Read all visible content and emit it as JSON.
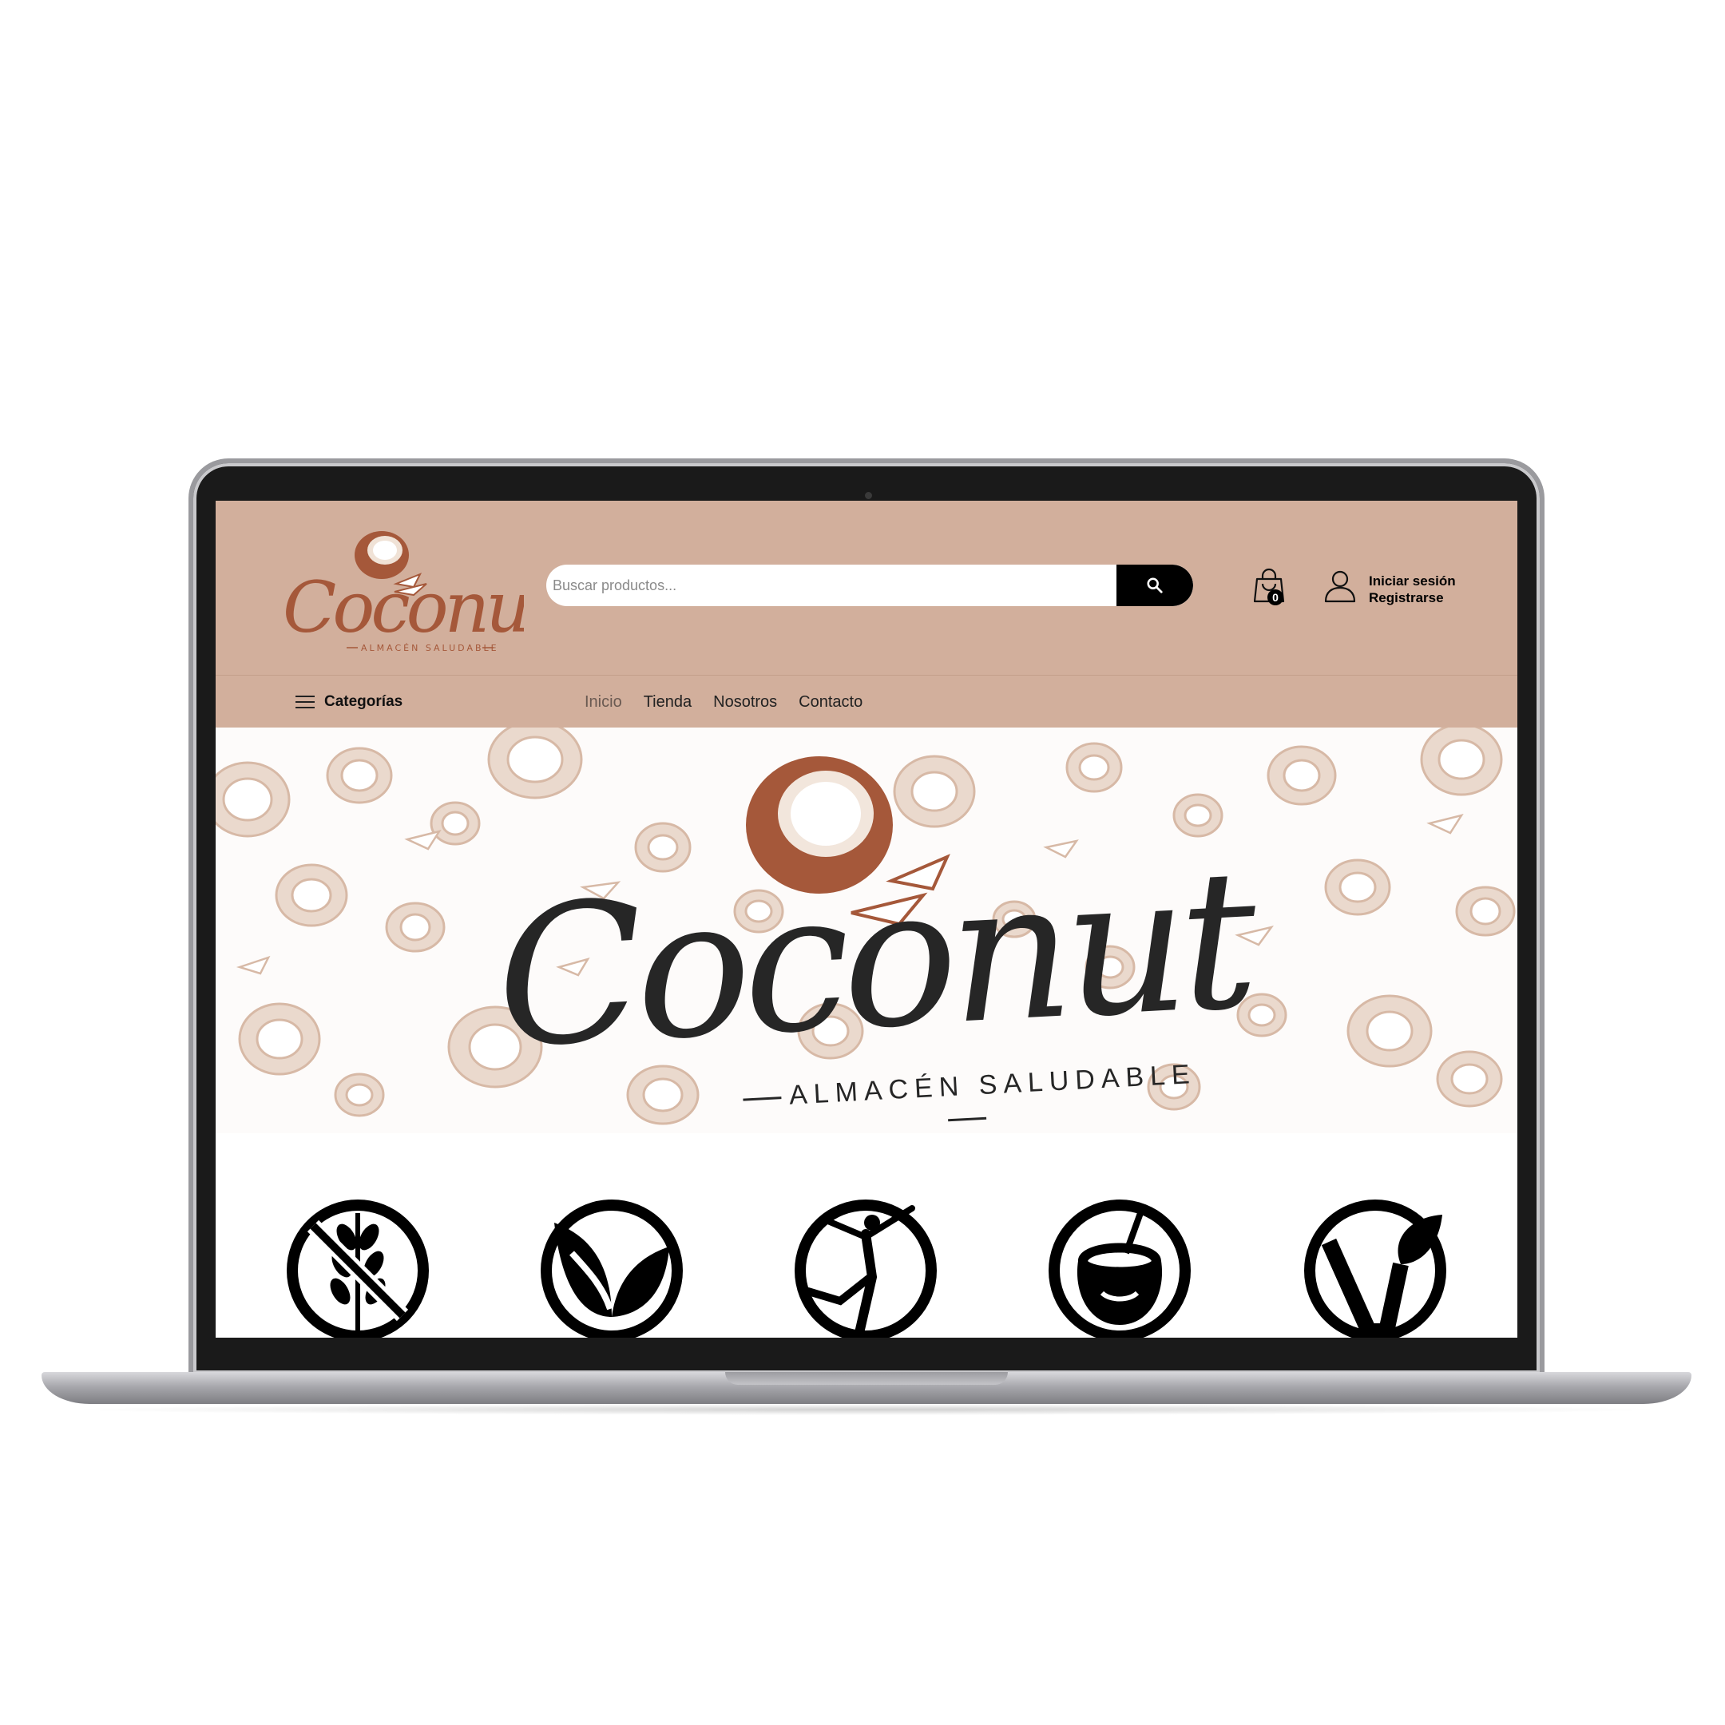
{
  "brand": {
    "name": "Coconut",
    "tagline": "ALMACÉN SALUDABLE"
  },
  "search": {
    "placeholder": "Buscar productos..."
  },
  "cart": {
    "count": "0"
  },
  "account": {
    "login_label": "Iniciar sesión",
    "register_label": "Registrarse"
  },
  "nav": {
    "categories_label": "Categorías",
    "menu": [
      {
        "label": "Inicio",
        "active": true
      },
      {
        "label": "Tienda",
        "active": false
      },
      {
        "label": "Nosotros",
        "active": false
      },
      {
        "label": "Contacto",
        "active": false
      }
    ]
  },
  "hero": {
    "title": "Coconut",
    "subtitle": "ALMACÉN SALUDABLE"
  },
  "badges": [
    {
      "icon": "gluten-free-icon"
    },
    {
      "icon": "natural-leaf-icon"
    },
    {
      "icon": "fitness-icon"
    },
    {
      "icon": "coconut-sugar-icon"
    },
    {
      "icon": "vegan-icon"
    }
  ],
  "colors": {
    "header_bg": "#d2af9c",
    "brand_brown": "#a5583a",
    "pattern_tan": "#d7b9a6",
    "text_dark": "#262626"
  }
}
